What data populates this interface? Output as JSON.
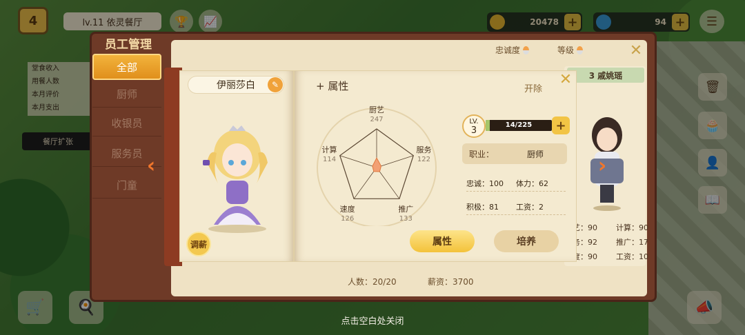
{
  "hud": {
    "level": "4",
    "restaurant_name": "lv.11 依灵餐厅",
    "gold": "20478",
    "gems": "94",
    "stats": [
      "堂食收入",
      "用餐人数",
      "本月评价",
      "本月支出"
    ],
    "expand_label": "餐厅扩张",
    "close_hint": "点击空白处关闭"
  },
  "panel": {
    "title": "员工管理",
    "tabs": [
      "全部",
      "厨师",
      "收银员",
      "服务员",
      "门童"
    ],
    "active_tab": "全部",
    "sort_loyalty": "忠诚度",
    "sort_level": "等级",
    "footer_count": "人数：20/20",
    "footer_salary": "薪资：3700"
  },
  "staff": {
    "name": "伊丽莎白",
    "salary_button": "调薪",
    "section_title": "属性",
    "dismiss": "开除",
    "level_label": "LV.",
    "level": "3",
    "exp_text": "14/225",
    "exp_progress": 0.062,
    "job_label": "职业：",
    "job": "厨师",
    "loyalty": "忠诚：100",
    "stamina": "体力：62",
    "positivity": "积极：81",
    "wage": "工资：2",
    "tab_attributes": "属性",
    "tab_train": "培养"
  },
  "radar": {
    "labels": [
      "厨艺",
      "服务",
      "推广",
      "速度",
      "计算"
    ],
    "values": [
      247,
      122,
      133,
      126,
      114
    ],
    "max": 1000,
    "fill_color": "#f2a074"
  },
  "next_staff": {
    "name_partial": "3  戚姚瑶",
    "stats": [
      [
        "艺：90",
        "计算：90"
      ],
      [
        "务：92",
        "推广：17"
      ],
      [
        "度：90",
        "工资：10"
      ]
    ]
  },
  "colors": {
    "accent_orange": "#f0762c",
    "tab_active": "#f3c23a",
    "panel_brown": "#6e3a27"
  }
}
